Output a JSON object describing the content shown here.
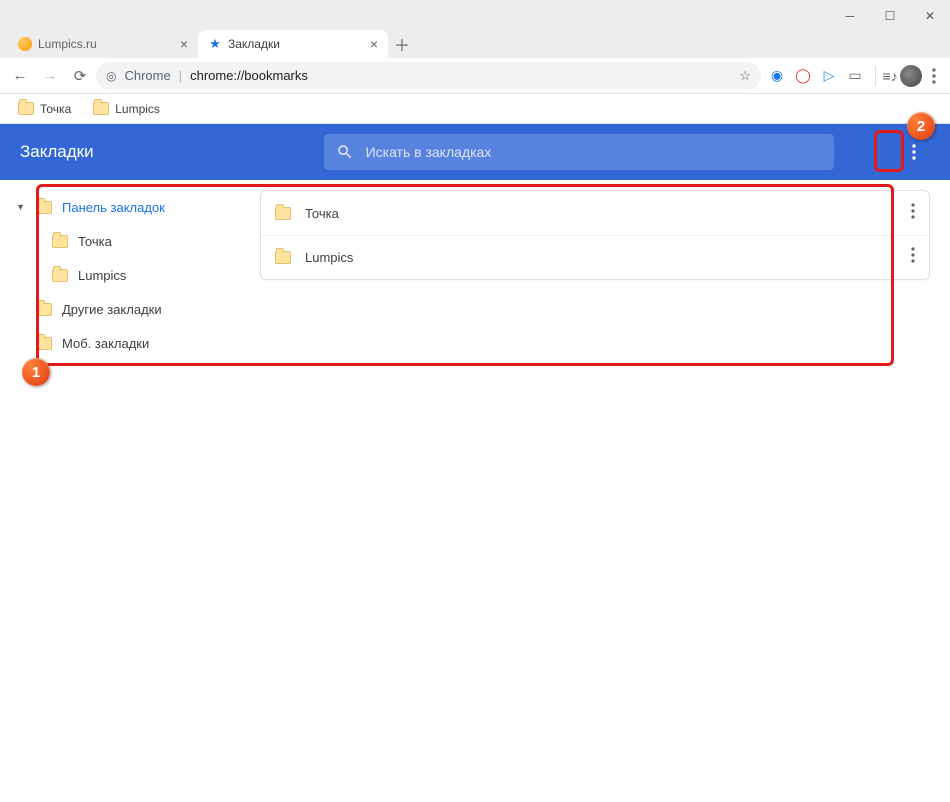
{
  "window": {
    "tabs": [
      {
        "label": "Lumpics.ru",
        "active": false
      },
      {
        "label": "Закладки",
        "active": true
      }
    ]
  },
  "toolbar": {
    "url_host": "Chrome",
    "url_path": "chrome://bookmarks"
  },
  "bookmarks_bar": {
    "items": [
      {
        "label": "Точка"
      },
      {
        "label": "Lumpics"
      }
    ]
  },
  "bookmarks_page": {
    "title": "Закладки",
    "search_placeholder": "Искать в закладках",
    "sidebar": {
      "root": "Панель закладок",
      "children": [
        {
          "label": "Точка"
        },
        {
          "label": "Lumpics"
        }
      ],
      "other": "Другие закладки",
      "mobile": "Моб. закладки"
    },
    "content": [
      {
        "label": "Точка"
      },
      {
        "label": "Lumpics"
      }
    ]
  },
  "annotations": {
    "badge1": "1",
    "badge2": "2"
  }
}
